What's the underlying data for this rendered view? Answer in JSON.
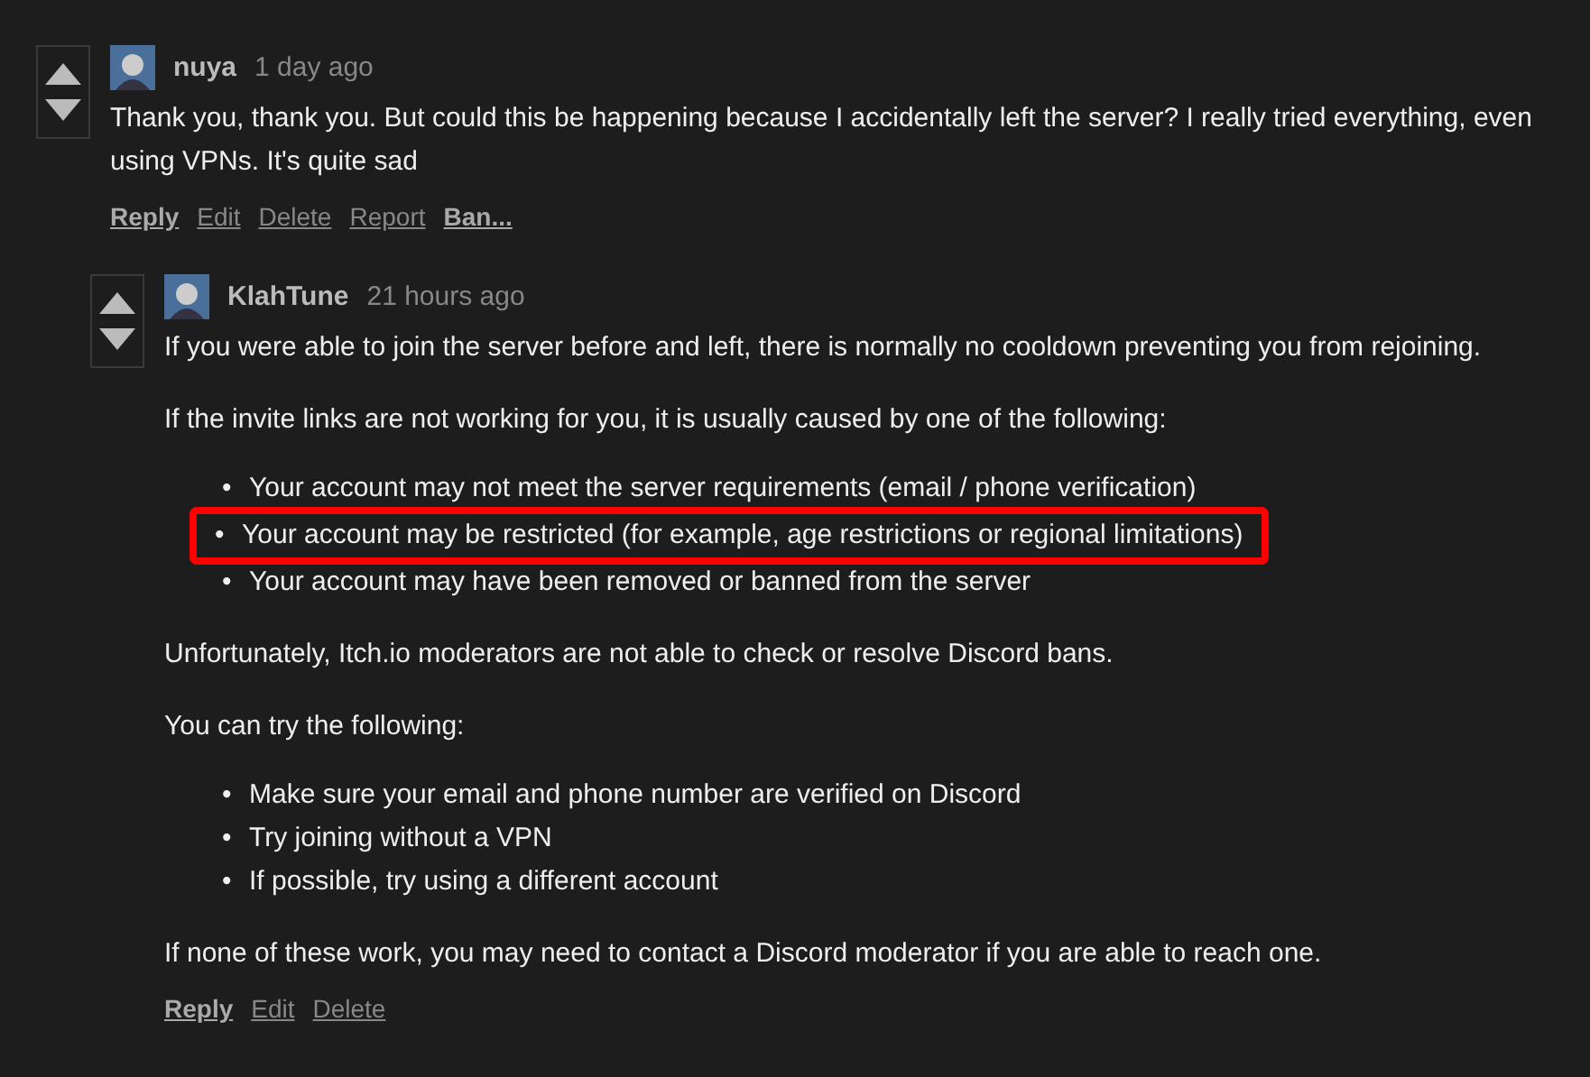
{
  "comments": [
    {
      "author": "nuya",
      "time": "1 day ago",
      "body": [
        {
          "kind": "paragraph",
          "text": "Thank you, thank you. But could this be happening because I accidentally left the server? I really tried everything, even using VPNs. It's quite sad"
        }
      ],
      "actions": [
        {
          "label": "Reply",
          "bold": true
        },
        {
          "label": "Edit",
          "bold": false
        },
        {
          "label": "Delete",
          "bold": false
        },
        {
          "label": "Report",
          "bold": false
        },
        {
          "label": "Ban...",
          "bold": true
        }
      ],
      "replies": [
        {
          "author": "KlahTune",
          "time": "21 hours ago",
          "body": [
            {
              "kind": "paragraph",
              "text": "If you were able to join the server before and left, there is normally no cooldown preventing you from rejoining."
            },
            {
              "kind": "paragraph",
              "text": "If the invite links are not working for you, it is usually caused by one of the following:"
            },
            {
              "kind": "list",
              "bullet": "•",
              "items": [
                {
                  "text": "Your account may not meet the server requirements (email / phone verification)",
                  "highlighted": false
                },
                {
                  "text": "Your account may be restricted (for example, age restrictions or regional limitations)",
                  "highlighted": true
                },
                {
                  "text": "Your account may have been removed or banned from the server",
                  "highlighted": false
                }
              ]
            },
            {
              "kind": "paragraph",
              "text": "Unfortunately, Itch.io moderators are not able to check or resolve Discord bans."
            },
            {
              "kind": "paragraph",
              "text": "You can try the following:"
            },
            {
              "kind": "list",
              "bullet": "•",
              "items": [
                {
                  "text": "Make sure your email and phone number are verified on Discord",
                  "highlighted": false
                },
                {
                  "text": "Try joining without a VPN",
                  "highlighted": false
                },
                {
                  "text": "If possible, try using a different account",
                  "highlighted": false
                }
              ]
            },
            {
              "kind": "paragraph",
              "text": "If none of these work, you may need to contact a Discord moderator if you are able to reach one."
            }
          ],
          "actions": [
            {
              "label": "Reply",
              "bold": true
            },
            {
              "label": "Edit",
              "bold": false
            },
            {
              "label": "Delete",
              "bold": false
            }
          ]
        }
      ]
    }
  ]
}
